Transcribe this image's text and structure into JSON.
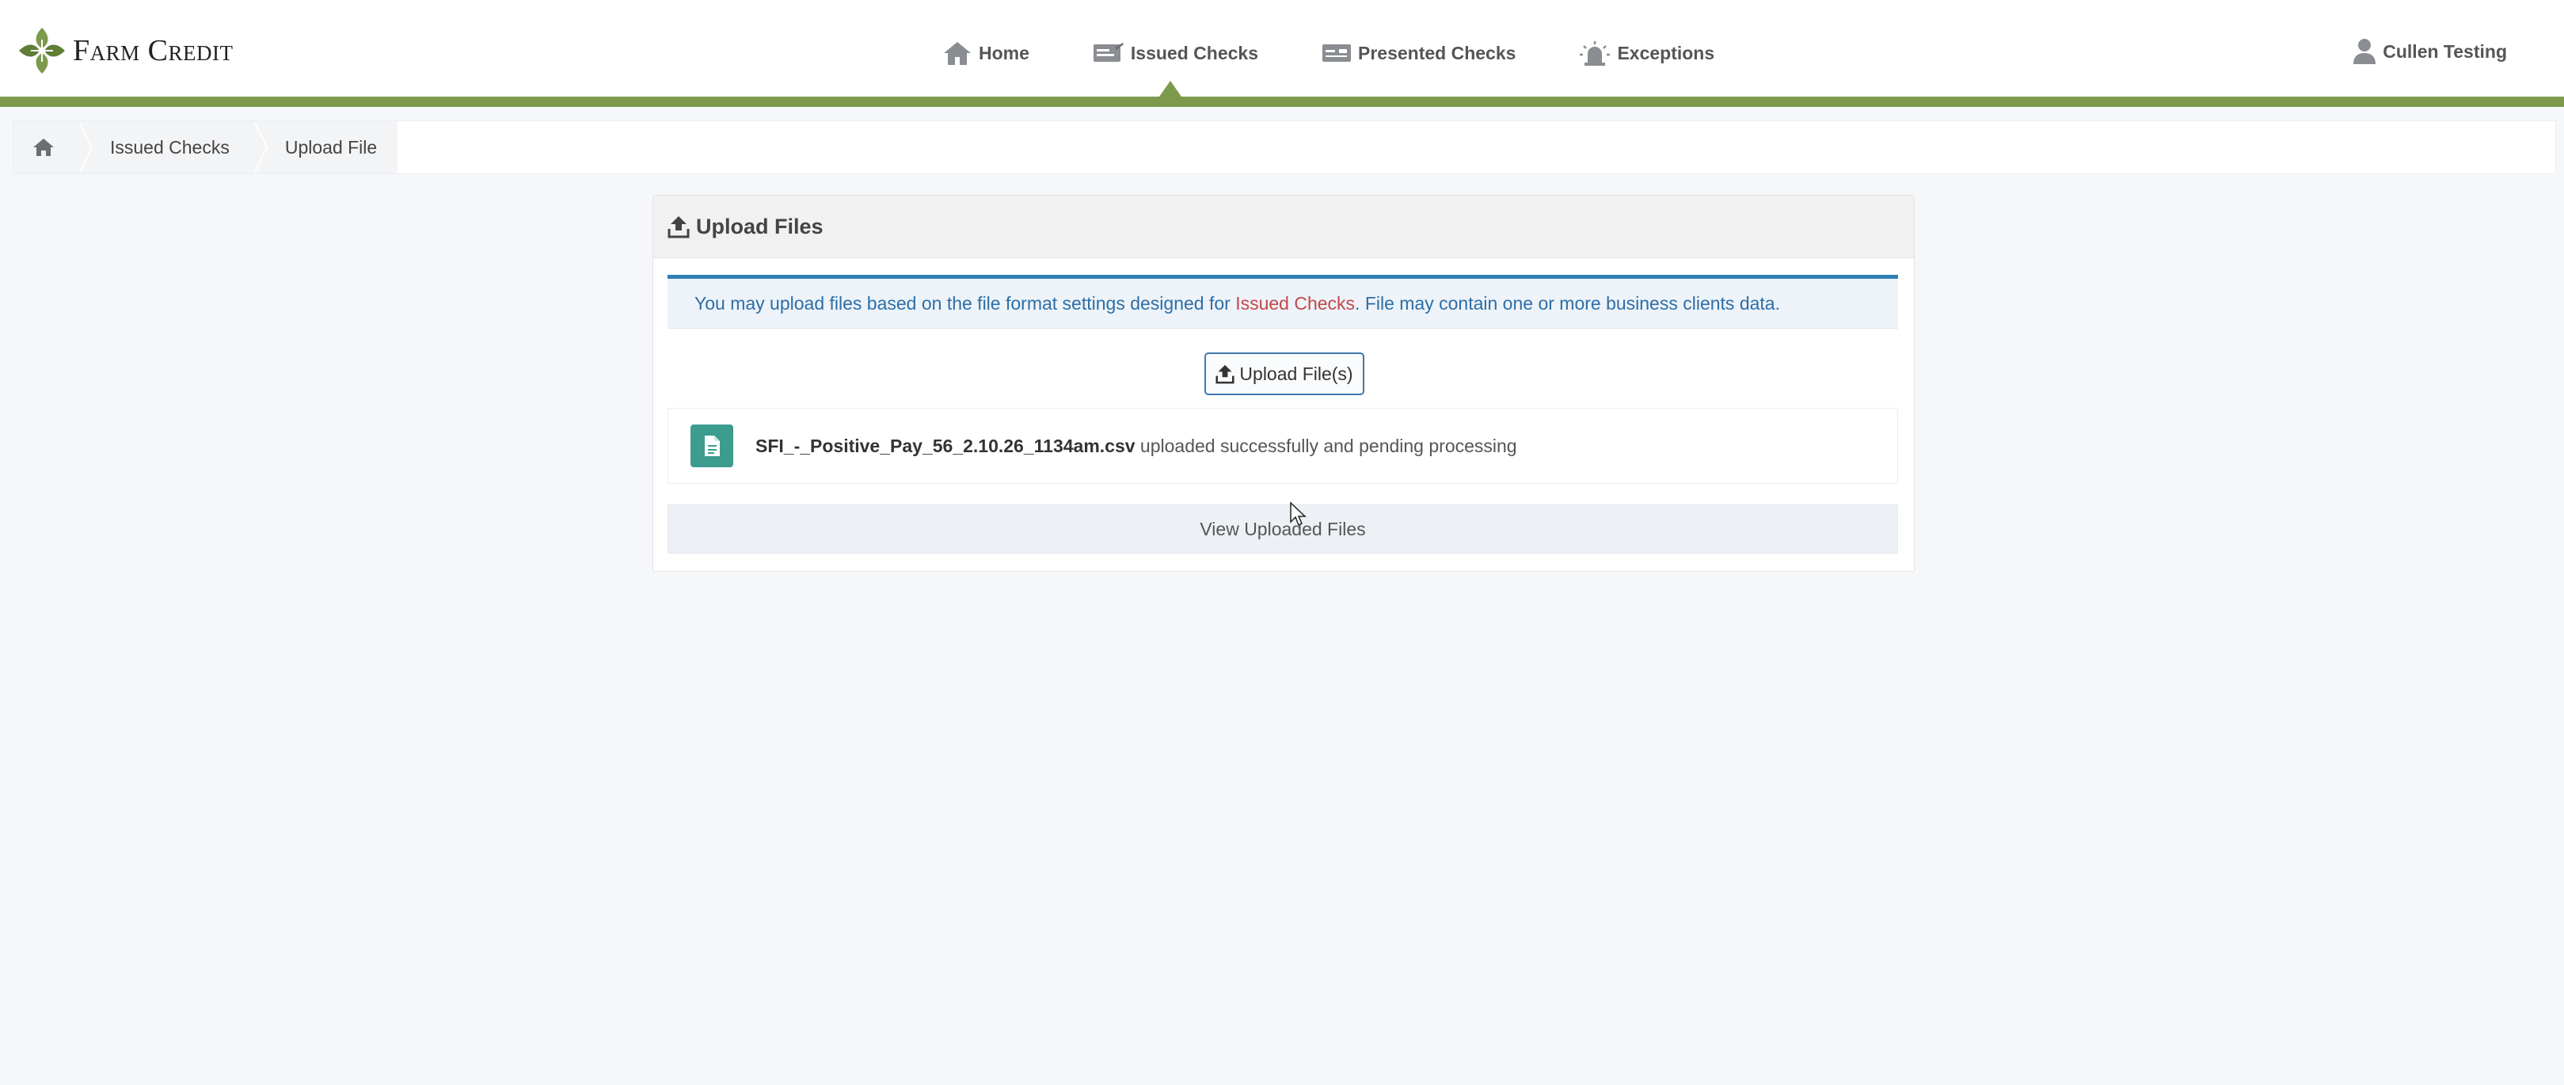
{
  "brand": {
    "name": "Farm Credit",
    "logo_icon": "farm-credit-leaf-logo",
    "accent": "#7d9a4c"
  },
  "nav": {
    "items": [
      {
        "label": "Home",
        "icon": "home-icon"
      },
      {
        "label": "Issued Checks",
        "icon": "issued-checks-icon",
        "active": true
      },
      {
        "label": "Presented Checks",
        "icon": "presented-checks-icon"
      },
      {
        "label": "Exceptions",
        "icon": "exceptions-alarm-icon"
      }
    ]
  },
  "user": {
    "name": "Cullen Testing",
    "icon": "user-icon"
  },
  "breadcrumb": {
    "home_icon": "home-icon",
    "items": [
      "Issued Checks",
      "Upload File"
    ]
  },
  "panel": {
    "title": "Upload Files",
    "title_icon": "upload-icon",
    "info": {
      "prefix": "You may upload files based on the file format settings designed for ",
      "link": "Issued Checks",
      "suffix": ". File may contain one or more business clients data."
    },
    "upload_button": "Upload File(s)",
    "file": {
      "icon": "file-document-icon",
      "name": "SFI_-_Positive_Pay_56_2.10.26_1134am.csv",
      "status": " uploaded successfully and pending processing"
    },
    "view_button": "View Uploaded Files"
  },
  "colors": {
    "header_line": "#7d9a4c",
    "alert_border": "#2f7cb4",
    "alert_text": "#2d6ea8",
    "link_text": "#c3474a",
    "file_icon_bg": "#3c9c8e"
  }
}
